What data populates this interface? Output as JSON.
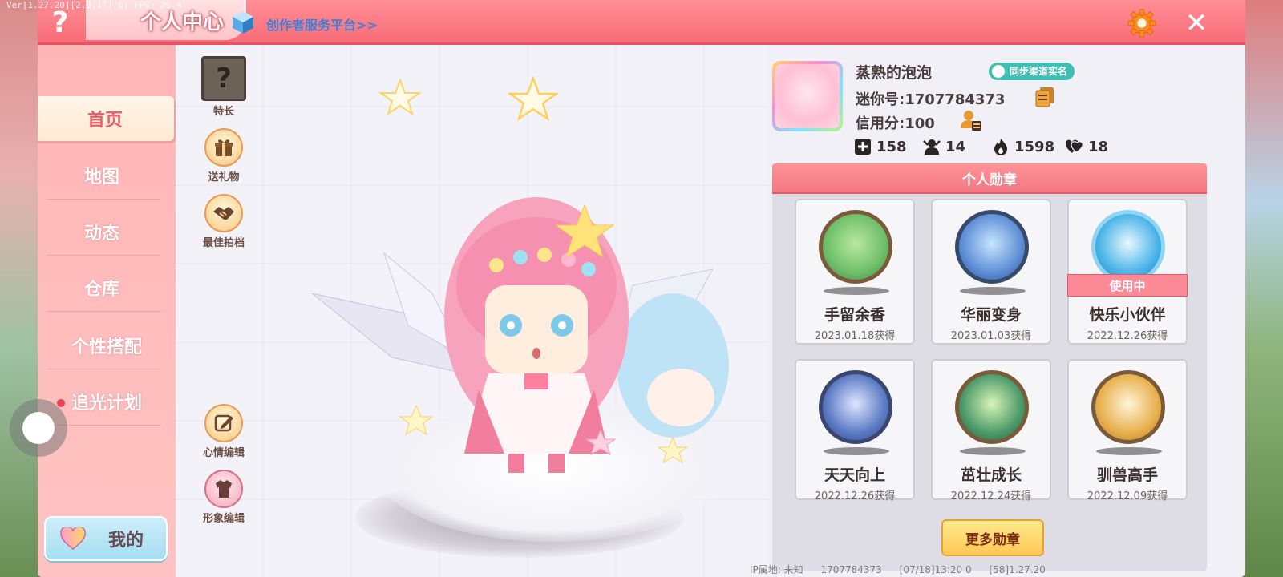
{
  "version_text": "Ver[1.27.20][2.3.17][0] FPS: 29.4",
  "header": {
    "title": "个人中心",
    "creator_link": "创作者服务平台>>",
    "help_icon": "question-icon",
    "settings_icon": "gear-icon",
    "close_icon": "close-icon",
    "accent": "#f76c78"
  },
  "sidebar": {
    "items": [
      {
        "label": "首页",
        "active": true
      },
      {
        "label": "地图"
      },
      {
        "label": "动态"
      },
      {
        "label": "仓库"
      },
      {
        "label": "个性搭配"
      },
      {
        "label": "追光计划",
        "dot": true
      }
    ],
    "mine_button": "我的"
  },
  "scene": {
    "buttons": [
      {
        "label": "特长",
        "icon": "question-box-icon"
      },
      {
        "label": "送礼物",
        "icon": "gift-icon"
      },
      {
        "label": "最佳拍档",
        "icon": "handshake-icon"
      },
      {
        "label": "心情编辑",
        "icon": "edit-icon"
      },
      {
        "label": "形象编辑",
        "icon": "outfit-icon"
      }
    ]
  },
  "profile": {
    "nickname": "蒸熟的泡泡",
    "sync_badge": "同步渠道实名",
    "mini_id": "迷你号:1707784373",
    "credit": "信用分:100",
    "stats": [
      {
        "icon": "add-friend-icon",
        "value": "158"
      },
      {
        "icon": "fans-icon",
        "value": "14"
      },
      {
        "icon": "flame-icon",
        "value": "1598"
      },
      {
        "icon": "heart-icon",
        "value": "18"
      }
    ]
  },
  "medals": {
    "title": "个人勋章",
    "items": [
      {
        "name": "手留余香",
        "date": "2023.01.18获得",
        "color": "#7bbf6a"
      },
      {
        "name": "华丽变身",
        "date": "2023.01.03获得",
        "color": "#5f8fd6"
      },
      {
        "name": "快乐小伙伴",
        "date": "2022.12.26获得",
        "color": "#4ab4e8",
        "badge": "使用中"
      },
      {
        "name": "天天向上",
        "date": "2022.12.26获得",
        "color": "#5c7bc4"
      },
      {
        "name": "茁壮成长",
        "date": "2022.12.24获得",
        "color": "#4d9a6a"
      },
      {
        "name": "驯兽高手",
        "date": "2022.12.09获得",
        "color": "#e8b04e"
      }
    ],
    "more_button": "更多勋章"
  },
  "footer": {
    "ip": "IP属地: 未知",
    "uid": "1707784373",
    "time": "[07/18]13:20 0",
    "ver": "[58]1.27.20"
  }
}
